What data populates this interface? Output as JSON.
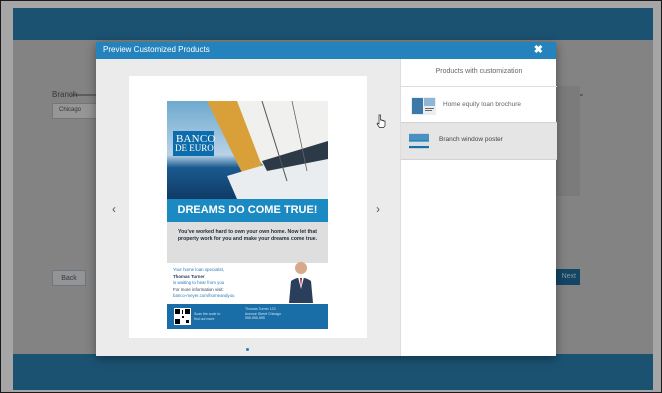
{
  "background": {
    "branch_label": "Branch",
    "branch_value": "Chicago",
    "back_label": "Back",
    "next_label": "Next"
  },
  "modal": {
    "title": "Preview Customized Products",
    "close_glyph": "✖",
    "prev_glyph": "‹",
    "next_glyph": "›"
  },
  "poster": {
    "brand_line1": "BANCO",
    "brand_line2": "DE EURO",
    "headline": "DREAMS DO COME TRUE!",
    "message": "You've worked hard to own your own home. Now let that property work for you and make your dreams come true.",
    "contact_line1": "Your home loan specialist,",
    "contact_name": "Thomas Turner",
    "contact_line3": "is waiting to hear from you",
    "contact_line4": "For more information visit:",
    "contact_url": "banco-meyer.com/homeandyou",
    "footer_text1": "Scan the code to find out more",
    "footer_text2": "Thomas Turner 123 Avenue Street Chicago 555-555-555"
  },
  "sidebar": {
    "title": "Products with customization",
    "items": [
      {
        "label": "Home equity loan brochure",
        "selected": false
      },
      {
        "label": "Branch window poster",
        "selected": true
      }
    ]
  },
  "colors": {
    "accent": "#2483bd",
    "header_bar": "#2a7eb0",
    "poster_blue": "#1c8ac2"
  },
  "icons": [
    "close-icon",
    "chevron-left-icon",
    "chevron-right-icon",
    "hand-pointer-icon"
  ]
}
